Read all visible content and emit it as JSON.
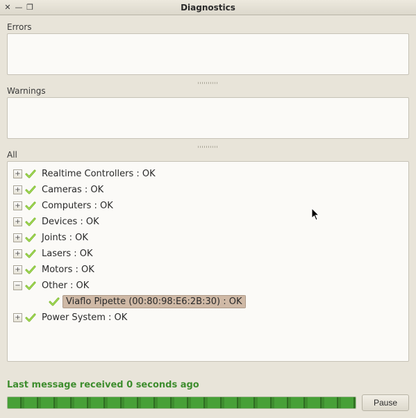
{
  "window": {
    "title": "Diagnostics"
  },
  "sections": {
    "errors_label": "Errors",
    "warnings_label": "Warnings",
    "all_label": "All"
  },
  "tree": {
    "items": [
      {
        "label": "Realtime Controllers : OK",
        "expanded": false,
        "ok": true
      },
      {
        "label": "Cameras : OK",
        "expanded": false,
        "ok": true
      },
      {
        "label": "Computers : OK",
        "expanded": false,
        "ok": true
      },
      {
        "label": "Devices : OK",
        "expanded": false,
        "ok": true
      },
      {
        "label": "Joints : OK",
        "expanded": false,
        "ok": true
      },
      {
        "label": "Lasers : OK",
        "expanded": false,
        "ok": true
      },
      {
        "label": "Motors : OK",
        "expanded": false,
        "ok": true
      },
      {
        "label": "Other : OK",
        "expanded": true,
        "ok": true,
        "children": [
          {
            "label": "Viaflo Pipette (00:80:98:E6:2B:30) : OK",
            "ok": true,
            "selected": true
          }
        ]
      },
      {
        "label": "Power System : OK",
        "expanded": false,
        "ok": true
      }
    ]
  },
  "status": {
    "last_message": "Last message received 0 seconds ago"
  },
  "controls": {
    "pause_label": "Pause"
  },
  "symbols": {
    "close": "✕",
    "minimize": "—",
    "restore": "❐",
    "plus": "+",
    "minus": "−"
  }
}
